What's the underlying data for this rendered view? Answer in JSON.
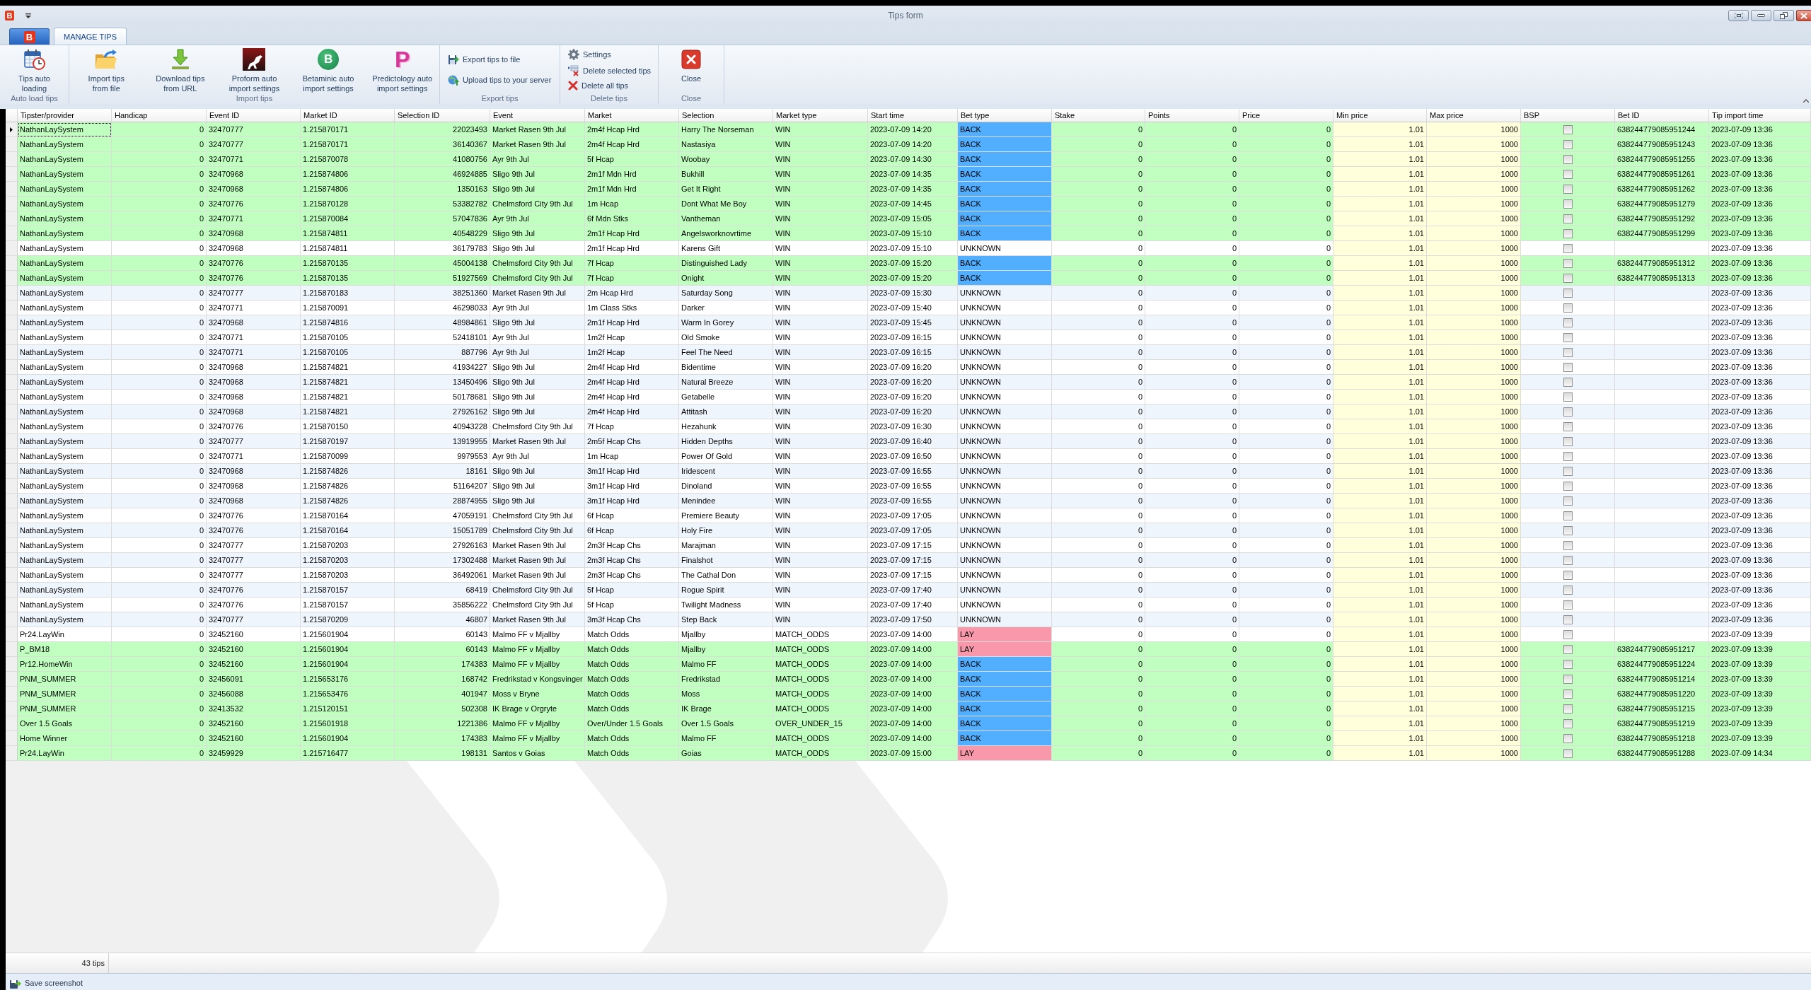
{
  "window": {
    "title": "Tips form",
    "logo": "B"
  },
  "ribbon": {
    "app_button": {
      "logo": "B"
    },
    "tabs": [
      {
        "label": "MANAGE TIPS",
        "selected": true
      }
    ],
    "groups": [
      {
        "label": "Auto load tips",
        "buttons": [
          {
            "kind": "large",
            "label": "Tips auto\nloading"
          }
        ]
      },
      {
        "label": "Import tips",
        "buttons": [
          {
            "kind": "large",
            "label": "Import tips\nfrom file"
          },
          {
            "kind": "large",
            "label": "Download tips\nfrom URL"
          },
          {
            "kind": "large",
            "label": "Proform auto\nimport settings"
          },
          {
            "kind": "large",
            "label": "Betaminic auto\nimport settings",
            "logo": "B"
          },
          {
            "kind": "large",
            "label": "Predictology auto\nimport settings",
            "logo": "P"
          }
        ]
      },
      {
        "label": "Export tips",
        "buttons": [
          {
            "kind": "small",
            "label": "Export tips to file"
          },
          {
            "kind": "small",
            "label": "Upload tips to your server"
          }
        ]
      },
      {
        "label": "Delete tips",
        "buttons": [
          {
            "kind": "small",
            "label": "Settings"
          },
          {
            "kind": "small",
            "label": "Delete selected tips"
          },
          {
            "kind": "small",
            "label": "Delete all tips"
          }
        ]
      },
      {
        "label": "Close",
        "buttons": [
          {
            "kind": "large",
            "label": "Close"
          }
        ]
      }
    ]
  },
  "table": {
    "columns": [
      {
        "label": "Tipster/provider",
        "kind": "text"
      },
      {
        "label": "Handicap",
        "kind": "number"
      },
      {
        "label": "Event ID",
        "kind": "text"
      },
      {
        "label": "Market ID",
        "kind": "text"
      },
      {
        "label": "Selection ID",
        "kind": "number"
      },
      {
        "label": "Event",
        "kind": "text"
      },
      {
        "label": "Market",
        "kind": "text"
      },
      {
        "label": "Selection",
        "kind": "text"
      },
      {
        "label": "Market type",
        "kind": "text"
      },
      {
        "label": "Start time",
        "kind": "text"
      },
      {
        "label": "Bet type",
        "kind": "bet"
      },
      {
        "label": "Stake",
        "kind": "number"
      },
      {
        "label": "Points",
        "kind": "number"
      },
      {
        "label": "Price",
        "kind": "number"
      },
      {
        "label": "Min price",
        "kind": "limit"
      },
      {
        "label": "Max price",
        "kind": "limit"
      },
      {
        "label": "BSP",
        "kind": "check"
      },
      {
        "label": "Bet ID",
        "kind": "text"
      },
      {
        "label": "Tip import time",
        "kind": "text"
      }
    ],
    "rows": [
      {
        "selected": true,
        "placed": true,
        "color": "#52aefe",
        "bsp": false,
        "cells": [
          "NathanLaySystem",
          "0",
          "32470777",
          "1.215870171",
          "22023493",
          "Market Rasen 9th Jul",
          "2m4f Hcap Hrd",
          "Harry The Norseman",
          "WIN",
          "2023-07-09 14:20",
          "BACK",
          "0",
          "0",
          "0",
          "1.01",
          "1000",
          "",
          "638244779085951244",
          "2023-07-09 13:36"
        ]
      },
      {
        "selected": false,
        "placed": true,
        "color": "#52aefe",
        "bsp": false,
        "cells": [
          "NathanLaySystem",
          "0",
          "32470777",
          "1.215870171",
          "36140367",
          "Market Rasen 9th Jul",
          "2m4f Hcap Hrd",
          "Nastasiya",
          "WIN",
          "2023-07-09 14:20",
          "BACK",
          "0",
          "0",
          "0",
          "1.01",
          "1000",
          "",
          "638244779085951243",
          "2023-07-09 13:36"
        ]
      },
      {
        "selected": false,
        "placed": true,
        "color": "#52aefe",
        "bsp": false,
        "cells": [
          "NathanLaySystem",
          "0",
          "32470771",
          "1.215870078",
          "41080756",
          "Ayr 9th Jul",
          "5f Hcap",
          "Woobay",
          "WIN",
          "2023-07-09 14:30",
          "BACK",
          "0",
          "0",
          "0",
          "1.01",
          "1000",
          "",
          "638244779085951255",
          "2023-07-09 13:36"
        ]
      },
      {
        "selected": false,
        "placed": true,
        "color": "#52aefe",
        "bsp": false,
        "cells": [
          "NathanLaySystem",
          "0",
          "32470968",
          "1.215874806",
          "46924885",
          "Sligo 9th Jul",
          "2m1f Mdn Hrd",
          "Bukhill",
          "WIN",
          "2023-07-09 14:35",
          "BACK",
          "0",
          "0",
          "0",
          "1.01",
          "1000",
          "",
          "638244779085951261",
          "2023-07-09 13:36"
        ]
      },
      {
        "selected": false,
        "placed": true,
        "color": "#52aefe",
        "bsp": false,
        "cells": [
          "NathanLaySystem",
          "0",
          "32470968",
          "1.215874806",
          "1350163",
          "Sligo 9th Jul",
          "2m1f Mdn Hrd",
          "Get It Right",
          "WIN",
          "2023-07-09 14:35",
          "BACK",
          "0",
          "0",
          "0",
          "1.01",
          "1000",
          "",
          "638244779085951262",
          "2023-07-09 13:36"
        ]
      },
      {
        "selected": false,
        "placed": true,
        "color": "#52aefe",
        "bsp": false,
        "cells": [
          "NathanLaySystem",
          "0",
          "32470776",
          "1.215870128",
          "53382782",
          "Chelmsford City 9th Jul",
          "1m Hcap",
          "Dont What Me Boy",
          "WIN",
          "2023-07-09 14:45",
          "BACK",
          "0",
          "0",
          "0",
          "1.01",
          "1000",
          "",
          "638244779085951279",
          "2023-07-09 13:36"
        ]
      },
      {
        "selected": false,
        "placed": true,
        "color": "#52aefe",
        "bsp": false,
        "cells": [
          "NathanLaySystem",
          "0",
          "32470771",
          "1.215870084",
          "57047836",
          "Ayr 9th Jul",
          "6f Mdn Stks",
          "Vantheman",
          "WIN",
          "2023-07-09 15:05",
          "BACK",
          "0",
          "0",
          "0",
          "1.01",
          "1000",
          "",
          "638244779085951292",
          "2023-07-09 13:36"
        ]
      },
      {
        "selected": false,
        "placed": true,
        "color": "#52aefe",
        "bsp": false,
        "cells": [
          "NathanLaySystem",
          "0",
          "32470968",
          "1.215874811",
          "40548229",
          "Sligo 9th Jul",
          "2m1f Hcap Hrd",
          "Angelsworknovrtime",
          "WIN",
          "2023-07-09 15:10",
          "BACK",
          "0",
          "0",
          "0",
          "1.01",
          "1000",
          "",
          "638244779085951299",
          "2023-07-09 13:36"
        ]
      },
      {
        "selected": false,
        "placed": false,
        "bsp": false,
        "cells": [
          "NathanLaySystem",
          "0",
          "32470968",
          "1.215874811",
          "36179783",
          "Sligo 9th Jul",
          "2m1f Hcap Hrd",
          "Karens Gift",
          "WIN",
          "2023-07-09 15:10",
          "UNKNOWN",
          "0",
          "0",
          "0",
          "1.01",
          "1000",
          "",
          "",
          "2023-07-09 13:36"
        ]
      },
      {
        "selected": false,
        "placed": true,
        "color": "#52aefe",
        "bsp": false,
        "cells": [
          "NathanLaySystem",
          "0",
          "32470776",
          "1.215870135",
          "45004138",
          "Chelmsford City 9th Jul",
          "7f Hcap",
          "Distinguished Lady",
          "WIN",
          "2023-07-09 15:20",
          "BACK",
          "0",
          "0",
          "0",
          "1.01",
          "1000",
          "",
          "638244779085951312",
          "2023-07-09 13:36"
        ]
      },
      {
        "selected": false,
        "placed": true,
        "color": "#52aefe",
        "bsp": false,
        "cells": [
          "NathanLaySystem",
          "0",
          "32470776",
          "1.215870135",
          "51927569",
          "Chelmsford City 9th Jul",
          "7f Hcap",
          "Onight",
          "WIN",
          "2023-07-09 15:20",
          "BACK",
          "0",
          "0",
          "0",
          "1.01",
          "1000",
          "",
          "638244779085951313",
          "2023-07-09 13:36"
        ]
      },
      {
        "selected": false,
        "placed": false,
        "bsp": false,
        "cells": [
          "NathanLaySystem",
          "0",
          "32470777",
          "1.215870183",
          "38251360",
          "Market Rasen 9th Jul",
          "2m Hcap Hrd",
          "Saturday Song",
          "WIN",
          "2023-07-09 15:30",
          "UNKNOWN",
          "0",
          "0",
          "0",
          "1.01",
          "1000",
          "",
          "",
          "2023-07-09 13:36"
        ]
      },
      {
        "selected": false,
        "placed": false,
        "bsp": false,
        "cells": [
          "NathanLaySystem",
          "0",
          "32470771",
          "1.215870091",
          "46298033",
          "Ayr 9th Jul",
          "1m Class Stks",
          "Darker",
          "WIN",
          "2023-07-09 15:40",
          "UNKNOWN",
          "0",
          "0",
          "0",
          "1.01",
          "1000",
          "",
          "",
          "2023-07-09 13:36"
        ]
      },
      {
        "selected": false,
        "placed": false,
        "bsp": false,
        "cells": [
          "NathanLaySystem",
          "0",
          "32470968",
          "1.215874816",
          "48984861",
          "Sligo 9th Jul",
          "2m1f Hcap Hrd",
          "Warm In Gorey",
          "WIN",
          "2023-07-09 15:45",
          "UNKNOWN",
          "0",
          "0",
          "0",
          "1.01",
          "1000",
          "",
          "",
          "2023-07-09 13:36"
        ]
      },
      {
        "selected": false,
        "placed": false,
        "bsp": false,
        "cells": [
          "NathanLaySystem",
          "0",
          "32470771",
          "1.215870105",
          "52418101",
          "Ayr 9th Jul",
          "1m2f Hcap",
          "Old Smoke",
          "WIN",
          "2023-07-09 16:15",
          "UNKNOWN",
          "0",
          "0",
          "0",
          "1.01",
          "1000",
          "",
          "",
          "2023-07-09 13:36"
        ]
      },
      {
        "selected": false,
        "placed": false,
        "bsp": false,
        "cells": [
          "NathanLaySystem",
          "0",
          "32470771",
          "1.215870105",
          "887796",
          "Ayr 9th Jul",
          "1m2f Hcap",
          "Feel The Need",
          "WIN",
          "2023-07-09 16:15",
          "UNKNOWN",
          "0",
          "0",
          "0",
          "1.01",
          "1000",
          "",
          "",
          "2023-07-09 13:36"
        ]
      },
      {
        "selected": false,
        "placed": false,
        "bsp": false,
        "cells": [
          "NathanLaySystem",
          "0",
          "32470968",
          "1.215874821",
          "41934227",
          "Sligo 9th Jul",
          "2m4f Hcap Hrd",
          "Bidentime",
          "WIN",
          "2023-07-09 16:20",
          "UNKNOWN",
          "0",
          "0",
          "0",
          "1.01",
          "1000",
          "",
          "",
          "2023-07-09 13:36"
        ]
      },
      {
        "selected": false,
        "placed": false,
        "bsp": false,
        "cells": [
          "NathanLaySystem",
          "0",
          "32470968",
          "1.215874821",
          "13450496",
          "Sligo 9th Jul",
          "2m4f Hcap Hrd",
          "Natural Breeze",
          "WIN",
          "2023-07-09 16:20",
          "UNKNOWN",
          "0",
          "0",
          "0",
          "1.01",
          "1000",
          "",
          "",
          "2023-07-09 13:36"
        ]
      },
      {
        "selected": false,
        "placed": false,
        "bsp": false,
        "cells": [
          "NathanLaySystem",
          "0",
          "32470968",
          "1.215874821",
          "50178681",
          "Sligo 9th Jul",
          "2m4f Hcap Hrd",
          "Getabelle",
          "WIN",
          "2023-07-09 16:20",
          "UNKNOWN",
          "0",
          "0",
          "0",
          "1.01",
          "1000",
          "",
          "",
          "2023-07-09 13:36"
        ]
      },
      {
        "selected": false,
        "placed": false,
        "bsp": false,
        "cells": [
          "NathanLaySystem",
          "0",
          "32470968",
          "1.215874821",
          "27926162",
          "Sligo 9th Jul",
          "2m4f Hcap Hrd",
          "Attitash",
          "WIN",
          "2023-07-09 16:20",
          "UNKNOWN",
          "0",
          "0",
          "0",
          "1.01",
          "1000",
          "",
          "",
          "2023-07-09 13:36"
        ]
      },
      {
        "selected": false,
        "placed": false,
        "bsp": false,
        "cells": [
          "NathanLaySystem",
          "0",
          "32470776",
          "1.215870150",
          "40943228",
          "Chelmsford City 9th Jul",
          "7f Hcap",
          "Hezahunk",
          "WIN",
          "2023-07-09 16:30",
          "UNKNOWN",
          "0",
          "0",
          "0",
          "1.01",
          "1000",
          "",
          "",
          "2023-07-09 13:36"
        ]
      },
      {
        "selected": false,
        "placed": false,
        "bsp": false,
        "cells": [
          "NathanLaySystem",
          "0",
          "32470777",
          "1.215870197",
          "13919955",
          "Market Rasen 9th Jul",
          "2m5f Hcap Chs",
          "Hidden Depths",
          "WIN",
          "2023-07-09 16:40",
          "UNKNOWN",
          "0",
          "0",
          "0",
          "1.01",
          "1000",
          "",
          "",
          "2023-07-09 13:36"
        ]
      },
      {
        "selected": false,
        "placed": false,
        "bsp": false,
        "cells": [
          "NathanLaySystem",
          "0",
          "32470771",
          "1.215870099",
          "9979553",
          "Ayr 9th Jul",
          "1m Hcap",
          "Power Of Gold",
          "WIN",
          "2023-07-09 16:50",
          "UNKNOWN",
          "0",
          "0",
          "0",
          "1.01",
          "1000",
          "",
          "",
          "2023-07-09 13:36"
        ]
      },
      {
        "selected": false,
        "placed": false,
        "bsp": false,
        "cells": [
          "NathanLaySystem",
          "0",
          "32470968",
          "1.215874826",
          "18161",
          "Sligo 9th Jul",
          "3m1f Hcap Hrd",
          "Iridescent",
          "WIN",
          "2023-07-09 16:55",
          "UNKNOWN",
          "0",
          "0",
          "0",
          "1.01",
          "1000",
          "",
          "",
          "2023-07-09 13:36"
        ]
      },
      {
        "selected": false,
        "placed": false,
        "bsp": false,
        "cells": [
          "NathanLaySystem",
          "0",
          "32470968",
          "1.215874826",
          "51164207",
          "Sligo 9th Jul",
          "3m1f Hcap Hrd",
          "Dinoland",
          "WIN",
          "2023-07-09 16:55",
          "UNKNOWN",
          "0",
          "0",
          "0",
          "1.01",
          "1000",
          "",
          "",
          "2023-07-09 13:36"
        ]
      },
      {
        "selected": false,
        "placed": false,
        "bsp": false,
        "cells": [
          "NathanLaySystem",
          "0",
          "32470968",
          "1.215874826",
          "28874955",
          "Sligo 9th Jul",
          "3m1f Hcap Hrd",
          "Menindee",
          "WIN",
          "2023-07-09 16:55",
          "UNKNOWN",
          "0",
          "0",
          "0",
          "1.01",
          "1000",
          "",
          "",
          "2023-07-09 13:36"
        ]
      },
      {
        "selected": false,
        "placed": false,
        "bsp": false,
        "cells": [
          "NathanLaySystem",
          "0",
          "32470776",
          "1.215870164",
          "47059191",
          "Chelmsford City 9th Jul",
          "6f Hcap",
          "Premiere Beauty",
          "WIN",
          "2023-07-09 17:05",
          "UNKNOWN",
          "0",
          "0",
          "0",
          "1.01",
          "1000",
          "",
          "",
          "2023-07-09 13:36"
        ]
      },
      {
        "selected": false,
        "placed": false,
        "bsp": false,
        "cells": [
          "NathanLaySystem",
          "0",
          "32470776",
          "1.215870164",
          "15051789",
          "Chelmsford City 9th Jul",
          "6f Hcap",
          "Holy Fire",
          "WIN",
          "2023-07-09 17:05",
          "UNKNOWN",
          "0",
          "0",
          "0",
          "1.01",
          "1000",
          "",
          "",
          "2023-07-09 13:36"
        ]
      },
      {
        "selected": false,
        "placed": false,
        "bsp": false,
        "cells": [
          "NathanLaySystem",
          "0",
          "32470777",
          "1.215870203",
          "27926163",
          "Market Rasen 9th Jul",
          "2m3f Hcap Chs",
          "Marajman",
          "WIN",
          "2023-07-09 17:15",
          "UNKNOWN",
          "0",
          "0",
          "0",
          "1.01",
          "1000",
          "",
          "",
          "2023-07-09 13:36"
        ]
      },
      {
        "selected": false,
        "placed": false,
        "bsp": false,
        "cells": [
          "NathanLaySystem",
          "0",
          "32470777",
          "1.215870203",
          "17302488",
          "Market Rasen 9th Jul",
          "2m3f Hcap Chs",
          "Finalshot",
          "WIN",
          "2023-07-09 17:15",
          "UNKNOWN",
          "0",
          "0",
          "0",
          "1.01",
          "1000",
          "",
          "",
          "2023-07-09 13:36"
        ]
      },
      {
        "selected": false,
        "placed": false,
        "bsp": false,
        "cells": [
          "NathanLaySystem",
          "0",
          "32470777",
          "1.215870203",
          "36492061",
          "Market Rasen 9th Jul",
          "2m3f Hcap Chs",
          "The Cathal Don",
          "WIN",
          "2023-07-09 17:15",
          "UNKNOWN",
          "0",
          "0",
          "0",
          "1.01",
          "1000",
          "",
          "",
          "2023-07-09 13:36"
        ]
      },
      {
        "selected": false,
        "placed": false,
        "bsp": false,
        "cells": [
          "NathanLaySystem",
          "0",
          "32470776",
          "1.215870157",
          "68419",
          "Chelmsford City 9th Jul",
          "5f Hcap",
          "Rogue Spirit",
          "WIN",
          "2023-07-09 17:40",
          "UNKNOWN",
          "0",
          "0",
          "0",
          "1.01",
          "1000",
          "",
          "",
          "2023-07-09 13:36"
        ]
      },
      {
        "selected": false,
        "placed": false,
        "bsp": false,
        "cells": [
          "NathanLaySystem",
          "0",
          "32470776",
          "1.215870157",
          "35856222",
          "Chelmsford City 9th Jul",
          "5f Hcap",
          "Twilight Madness",
          "WIN",
          "2023-07-09 17:40",
          "UNKNOWN",
          "0",
          "0",
          "0",
          "1.01",
          "1000",
          "",
          "",
          "2023-07-09 13:36"
        ]
      },
      {
        "selected": false,
        "placed": false,
        "bsp": false,
        "cells": [
          "NathanLaySystem",
          "0",
          "32470777",
          "1.215870209",
          "46807",
          "Market Rasen 9th Jul",
          "3m3f Hcap Chs",
          "Step Back",
          "WIN",
          "2023-07-09 17:50",
          "UNKNOWN",
          "0",
          "0",
          "0",
          "1.01",
          "1000",
          "",
          "",
          "2023-07-09 13:36"
        ]
      },
      {
        "selected": false,
        "placed": false,
        "color": "#f898aa",
        "bsp": false,
        "cells": [
          "Pr24.LayWin",
          "0",
          "32452160",
          "1.215601904",
          "60143",
          "Malmo FF v Mjallby",
          "Match Odds",
          "Mjallby",
          "MATCH_ODDS",
          "2023-07-09 14:00",
          "LAY",
          "0",
          "0",
          "0",
          "1.01",
          "1000",
          "",
          "",
          "2023-07-09 13:39"
        ]
      },
      {
        "selected": false,
        "placed": true,
        "color": "#f898aa",
        "bsp": false,
        "cells": [
          "P_BM18",
          "0",
          "32452160",
          "1.215601904",
          "60143",
          "Malmo FF v Mjallby",
          "Match Odds",
          "Mjallby",
          "MATCH_ODDS",
          "2023-07-09 14:00",
          "LAY",
          "0",
          "0",
          "0",
          "1.01",
          "1000",
          "",
          "638244779085951217",
          "2023-07-09 13:39"
        ]
      },
      {
        "selected": false,
        "placed": true,
        "color": "#52aefe",
        "bsp": false,
        "cells": [
          "Pr12.HomeWin",
          "0",
          "32452160",
          "1.215601904",
          "174383",
          "Malmo FF v Mjallby",
          "Match Odds",
          "Malmo FF",
          "MATCH_ODDS",
          "2023-07-09 14:00",
          "BACK",
          "0",
          "0",
          "0",
          "1.01",
          "1000",
          "",
          "638244779085951224",
          "2023-07-09 13:39"
        ]
      },
      {
        "selected": false,
        "placed": true,
        "color": "#52aefe",
        "bsp": false,
        "cells": [
          "PNM_SUMMER",
          "0",
          "32456091",
          "1.215653176",
          "168742",
          "Fredrikstad v Kongsvinger",
          "Match Odds",
          "Fredrikstad",
          "MATCH_ODDS",
          "2023-07-09 14:00",
          "BACK",
          "0",
          "0",
          "0",
          "1.01",
          "1000",
          "",
          "638244779085951214",
          "2023-07-09 13:39"
        ]
      },
      {
        "selected": false,
        "placed": true,
        "color": "#52aefe",
        "bsp": false,
        "cells": [
          "PNM_SUMMER",
          "0",
          "32456088",
          "1.215653476",
          "401947",
          "Moss v Bryne",
          "Match Odds",
          "Moss",
          "MATCH_ODDS",
          "2023-07-09 14:00",
          "BACK",
          "0",
          "0",
          "0",
          "1.01",
          "1000",
          "",
          "638244779085951220",
          "2023-07-09 13:39"
        ]
      },
      {
        "selected": false,
        "placed": true,
        "color": "#52aefe",
        "bsp": false,
        "cells": [
          "PNM_SUMMER",
          "0",
          "32413532",
          "1.215120151",
          "502308",
          "IK Brage v Orgryte",
          "Match Odds",
          "IK Brage",
          "MATCH_ODDS",
          "2023-07-09 14:00",
          "BACK",
          "0",
          "0",
          "0",
          "1.01",
          "1000",
          "",
          "638244779085951215",
          "2023-07-09 13:39"
        ]
      },
      {
        "selected": false,
        "placed": true,
        "color": "#52aefe",
        "bsp": false,
        "cells": [
          "Over 1.5 Goals",
          "0",
          "32452160",
          "1.215601918",
          "1221386",
          "Malmo FF v Mjallby",
          "Over/Under 1.5 Goals",
          "Over 1.5 Goals",
          "OVER_UNDER_15",
          "2023-07-09 14:00",
          "BACK",
          "0",
          "0",
          "0",
          "1.01",
          "1000",
          "",
          "638244779085951219",
          "2023-07-09 13:39"
        ]
      },
      {
        "selected": false,
        "placed": true,
        "color": "#52aefe",
        "bsp": false,
        "cells": [
          "Home Winner",
          "0",
          "32452160",
          "1.215601904",
          "174383",
          "Malmo FF v Mjallby",
          "Match Odds",
          "Malmo FF",
          "MATCH_ODDS",
          "2023-07-09 14:00",
          "BACK",
          "0",
          "0",
          "0",
          "1.01",
          "1000",
          "",
          "638244779085951218",
          "2023-07-09 13:39"
        ]
      },
      {
        "selected": false,
        "placed": true,
        "color": "#f898aa",
        "bsp": false,
        "cells": [
          "Pr24.LayWin",
          "0",
          "32459929",
          "1.215716477",
          "198131",
          "Santos v Goias",
          "Match Odds",
          "Goias",
          "MATCH_ODDS",
          "2023-07-09 15:00",
          "LAY",
          "0",
          "0",
          "0",
          "1.01",
          "1000",
          "",
          "638244779085951288",
          "2023-07-09 14:34"
        ]
      }
    ]
  },
  "status_bar": {
    "count": "43 tips"
  },
  "footer": {
    "button": "Save screenshot"
  }
}
